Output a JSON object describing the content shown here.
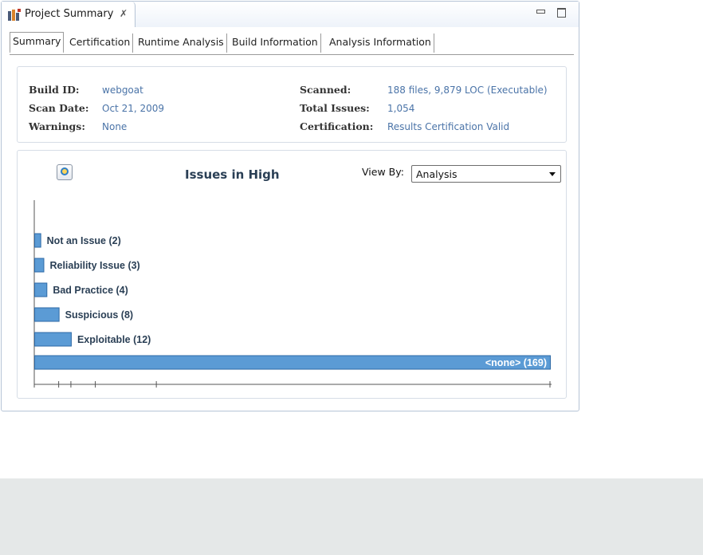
{
  "view": {
    "title": "Project Summary",
    "close_glyph": "✗",
    "icon": "project-summary-icon"
  },
  "tabs": [
    {
      "label": "Summary",
      "active": true
    },
    {
      "label": "Certification",
      "active": false
    },
    {
      "label": "Runtime Analysis",
      "active": false
    },
    {
      "label": "Build Information",
      "active": false
    },
    {
      "label": "Analysis Information",
      "active": false
    }
  ],
  "info": {
    "build_id_label": "Build ID:",
    "build_id": "webgoat",
    "scan_date_label": "Scan Date:",
    "scan_date": "Oct 21, 2009",
    "warnings_label": "Warnings:",
    "warnings": "None",
    "scanned_label": "Scanned:",
    "scanned": "188 files, 9,879 LOC (Executable)",
    "total_issues_label": "Total Issues:",
    "total_issues": "1,054",
    "certification_label": "Certification:",
    "certification": "Results Certification Valid"
  },
  "chart_panel": {
    "refresh_icon": "refresh-chart-icon",
    "view_by_label": "View By:",
    "view_by_value": "Analysis"
  },
  "chart_data": {
    "type": "bar",
    "orientation": "horizontal",
    "title": "Issues in High",
    "categories": [
      "Not an Issue",
      "Reliability Issue",
      "Bad Practice",
      "Suspicious",
      "Exploitable",
      "<none>"
    ],
    "values": [
      2,
      3,
      4,
      8,
      12,
      169
    ],
    "labels": [
      "Not an Issue (2)",
      "Reliability Issue (3)",
      "Bad Practice (4)",
      "Suspicious (8)",
      "Exploitable (12)",
      "<none> (169)"
    ],
    "xlim": [
      0,
      169
    ],
    "bar_color": "#5b9bd5",
    "bar_border": "#2e6aa6",
    "grid": false
  }
}
